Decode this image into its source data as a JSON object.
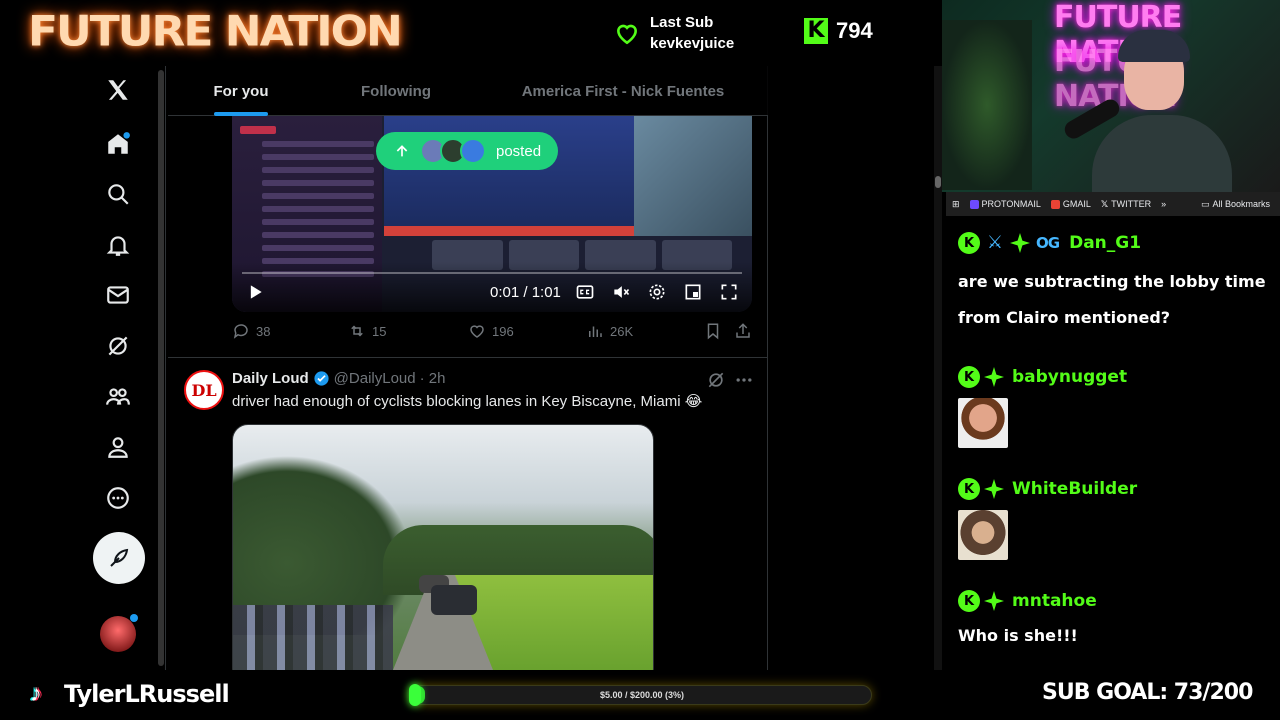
{
  "overlay": {
    "brand": "FUTURE NATION",
    "last_sub_label": "Last Sub",
    "last_sub_user": "kevkevjuice",
    "kick_count": "794",
    "streamer_name": "TylerLRussell",
    "goal_text": "$5.00 / $200.00 (3%)",
    "goal_progress": 0.03,
    "sub_goal": "SUB GOAL: 73/200",
    "accent_green": "#53fc18"
  },
  "x": {
    "tabs": [
      {
        "label": "For you",
        "active": true
      },
      {
        "label": "Following",
        "active": false
      },
      {
        "label": "America First - Nick Fuentes",
        "active": false
      }
    ],
    "nav_icons": [
      "x-logo-icon",
      "home-icon",
      "search-icon",
      "bell-icon",
      "mail-icon",
      "grok-icon",
      "communities-icon",
      "profile-icon",
      "more-icon"
    ],
    "video_post": {
      "posted_pill": "posted",
      "video_time": "0:01 / 1:01",
      "replies": "38",
      "reposts": "15",
      "likes": "196",
      "views": "26K"
    },
    "post": {
      "author": "Daily Loud",
      "handle": "@DailyLoud",
      "time": "· 2h",
      "text": "driver had enough of cyclists blocking lanes in Key Biscayne, Miami 😂"
    }
  },
  "bookmarks": {
    "items": [
      "PROTONMAIL",
      "GMAIL",
      "TWITTER"
    ],
    "all": "All Bookmarks"
  },
  "chat": {
    "messages": [
      {
        "user": "Dan_G1",
        "text": "are we subtracting the lobby time from Clairo mentioned?"
      },
      {
        "user": "babynugget",
        "text": ""
      },
      {
        "user": "WhiteBuilder",
        "text": ""
      },
      {
        "user": "mntahoe",
        "text": "Who is she!!!"
      }
    ]
  }
}
